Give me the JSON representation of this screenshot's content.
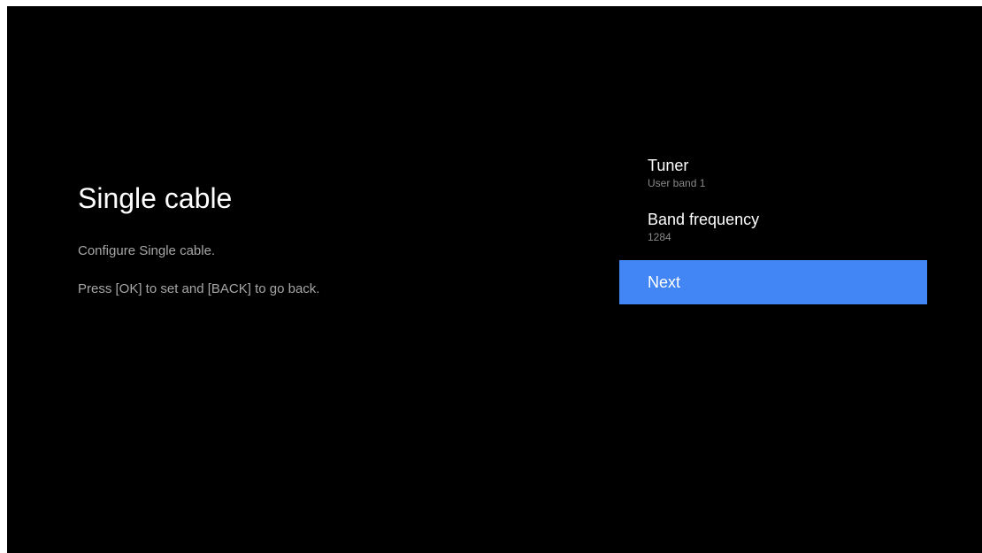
{
  "page": {
    "title": "Single cable",
    "description_1": "Configure Single cable.",
    "description_2": "Press [OK] to set and [BACK] to go back."
  },
  "menu": {
    "items": [
      {
        "label": "Tuner",
        "value": "User band 1"
      },
      {
        "label": "Band frequency",
        "value": "1284"
      },
      {
        "label": "Next"
      }
    ],
    "selected_index": 2
  },
  "colors": {
    "background": "#000000",
    "accent": "#4285f4",
    "primary_text": "#ffffff",
    "secondary_text": "#a6a6a6"
  }
}
